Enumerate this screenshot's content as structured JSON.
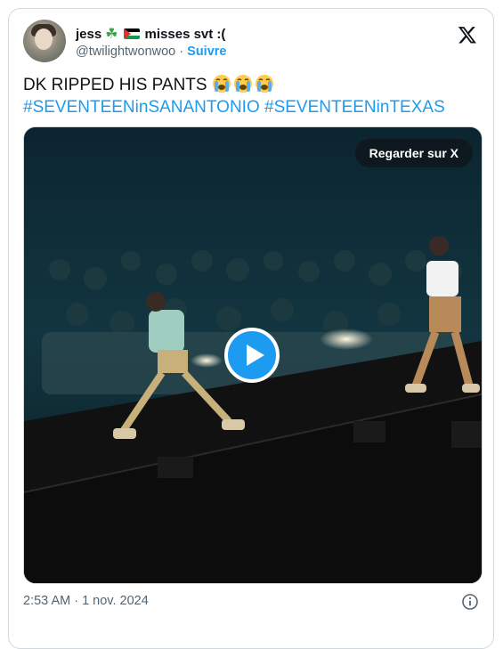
{
  "author": {
    "display_name": "jess",
    "name_suffix": "misses svt :(",
    "handle": "@twilightwonwoo",
    "separator": "·",
    "follow_label": "Suivre",
    "avatar_icon": "profile-photo",
    "emoji_icons": [
      "four-leaf-clover-icon",
      "palestine-flag-icon"
    ]
  },
  "tweet": {
    "text": "DK RIPPED HIS PANTS",
    "emoji": [
      "loudly-crying-face",
      "loudly-crying-face",
      "loudly-crying-face"
    ],
    "hashtags": "#SEVENTEENinSANANTONIO #SEVENTEENinTEXAS"
  },
  "media": {
    "watch_label": "Regarder sur X",
    "play_icon": "play-icon"
  },
  "footer": {
    "timestamp": "2:53 AM · 1 nov. 2024",
    "info_icon": "info-icon"
  },
  "colors": {
    "link": "#1d9bf0",
    "muted": "#536471",
    "text": "#0f1419",
    "border": "#cfd9de"
  }
}
